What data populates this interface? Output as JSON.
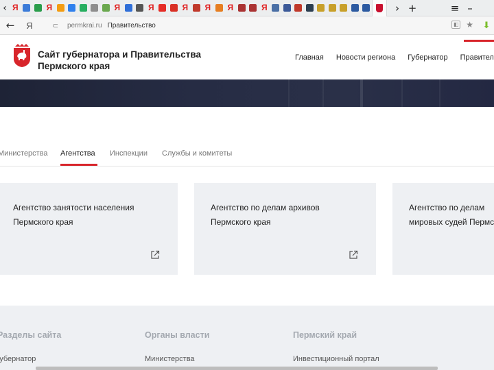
{
  "browser": {
    "tabs": [
      {
        "icon": "yandex-icon",
        "color": "#e02020",
        "text": "Я"
      },
      {
        "icon": "blue-square-icon",
        "color": "#3b7bd8",
        "text": ""
      },
      {
        "icon": "green-shield-icon",
        "color": "#2a9d4b",
        "text": ""
      },
      {
        "icon": "yandex-icon",
        "color": "#e02020",
        "text": "Я"
      },
      {
        "icon": "orange-icon",
        "color": "#f39c12",
        "text": ""
      },
      {
        "icon": "blue-icon",
        "color": "#2f80ed",
        "text": ""
      },
      {
        "icon": "green-icon",
        "color": "#27ae60",
        "text": ""
      },
      {
        "icon": "doc-icon",
        "color": "#8e8e8e",
        "text": ""
      },
      {
        "icon": "check-icon",
        "color": "#6aa84f",
        "text": ""
      },
      {
        "icon": "yandex-icon",
        "color": "#e02020",
        "text": "Я"
      },
      {
        "icon": "blue-icon",
        "color": "#2f6fd8",
        "text": ""
      },
      {
        "icon": "doc-icon",
        "color": "#555555",
        "text": ""
      },
      {
        "icon": "yandex-icon",
        "color": "#e02020",
        "text": "Я"
      },
      {
        "icon": "youtube-icon",
        "color": "#e52d27",
        "text": ""
      },
      {
        "icon": "red-icon",
        "color": "#d93025",
        "text": ""
      },
      {
        "icon": "yandex-icon",
        "color": "#e02020",
        "text": "Я"
      },
      {
        "icon": "red-icon",
        "color": "#c0392b",
        "text": ""
      },
      {
        "icon": "yandex-icon",
        "color": "#e02020",
        "text": "Я"
      },
      {
        "icon": "bars-icon",
        "color": "#e67e22",
        "text": ""
      },
      {
        "icon": "yandex-icon",
        "color": "#e02020",
        "text": "Я"
      },
      {
        "icon": "grid-icon",
        "color": "#a33",
        "text": ""
      },
      {
        "icon": "grid-icon",
        "color": "#a33",
        "text": ""
      },
      {
        "icon": "yandex-icon",
        "color": "#e02020",
        "text": "Я"
      },
      {
        "icon": "emblem-icon",
        "color": "#4a6fa5",
        "text": ""
      },
      {
        "icon": "emblem-icon",
        "color": "#3b5998",
        "text": ""
      },
      {
        "icon": "emblem-icon",
        "color": "#c0392b",
        "text": ""
      },
      {
        "icon": "emblem-icon",
        "color": "#2c3e50",
        "text": ""
      },
      {
        "icon": "bird-icon",
        "color": "#c8a02a",
        "text": ""
      },
      {
        "icon": "bird-icon",
        "color": "#c8a02a",
        "text": ""
      },
      {
        "icon": "bird-icon",
        "color": "#c8a02a",
        "text": ""
      },
      {
        "icon": "building-icon",
        "color": "#2c5aa0",
        "text": ""
      },
      {
        "icon": "building-icon",
        "color": "#2c5aa0",
        "text": ""
      }
    ],
    "address": {
      "yandex_label": "Я",
      "host": "permkrai.ru",
      "page_title": "Правительство"
    }
  },
  "site": {
    "title_line1": "Сайт губернатора и Правительства",
    "title_line2": "Пермского края",
    "nav": [
      {
        "label": "Главная"
      },
      {
        "label": "Новости региона"
      },
      {
        "label": "Губернатор"
      },
      {
        "label": "Правительство"
      }
    ],
    "subtabs": [
      {
        "label": "Министерства",
        "active": false
      },
      {
        "label": "Агентства",
        "active": true
      },
      {
        "label": "Инспекции",
        "active": false
      },
      {
        "label": "Службы и комитеты",
        "active": false
      }
    ],
    "cards": [
      {
        "line1": "Агентство занятости населения",
        "line2": "Пермского края"
      },
      {
        "line1": "Агентство по делам архивов",
        "line2": "Пермского края"
      },
      {
        "line1": "Агентство по делам",
        "line2": "мировых судей Пермского края"
      }
    ],
    "footer": {
      "columns": [
        {
          "heading": "Разделы сайта",
          "link": "Губернатор"
        },
        {
          "heading": "Органы власти",
          "link": "Министерства"
        },
        {
          "heading": "Пермский край",
          "link": "Инвестиционный портал"
        }
      ]
    }
  },
  "colors": {
    "accent": "#d8252b",
    "card_bg": "#eef0f3",
    "banner": "#262c44"
  }
}
